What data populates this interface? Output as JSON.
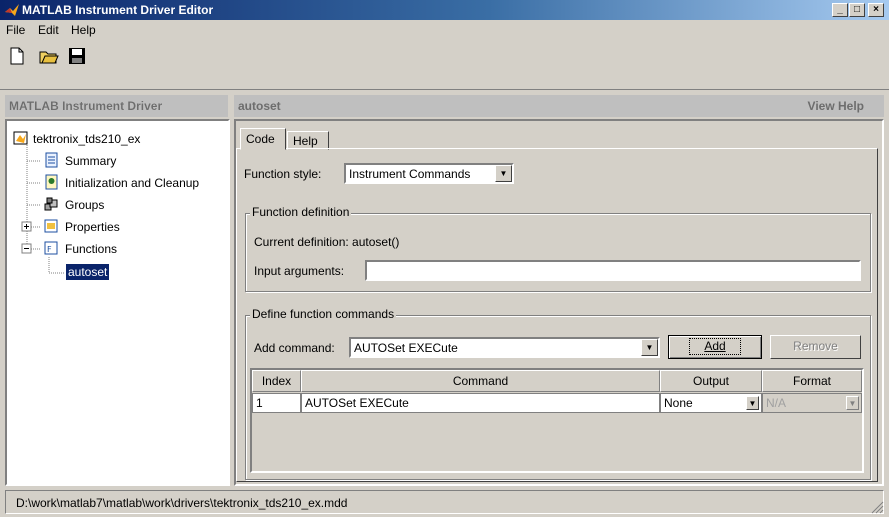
{
  "window": {
    "title": "MATLAB Instrument Driver Editor",
    "minimize": "_",
    "maximize": "□",
    "close": "×"
  },
  "menu": {
    "items": [
      "File",
      "Edit",
      "Help"
    ]
  },
  "toolbar": {
    "new": "new-file-icon",
    "open": "open-folder-icon",
    "save": "save-disk-icon"
  },
  "left_panel": {
    "header": "MATLAB Instrument Driver",
    "tree": {
      "root": "tektronix_tds210_ex",
      "items": [
        "Summary",
        "Initialization and Cleanup",
        "Groups",
        "Properties",
        "Functions"
      ],
      "function_child": "autoset"
    }
  },
  "right_panel": {
    "header": "autoset",
    "view_help": "View Help",
    "tabs": [
      "Code",
      "Help"
    ],
    "function_style_label": "Function style:",
    "function_style_value": "Instrument Commands",
    "function_definition": {
      "legend": "Function definition",
      "current_definition": "Current definition: autoset()",
      "input_arguments_label": "Input arguments:",
      "input_arguments_value": ""
    },
    "define_commands": {
      "legend": "Define function commands",
      "add_command_label": "Add command:",
      "add_command_value": "AUTOSet EXECute",
      "add_button": "Add",
      "remove_button": "Remove",
      "table": {
        "columns": [
          "Index",
          "Command",
          "Output",
          "Format"
        ],
        "rows": [
          {
            "index": "1",
            "command": "AUTOSet EXECute",
            "output": "None",
            "format": "N/A"
          }
        ]
      }
    }
  },
  "status_bar": {
    "path": "D:\\work\\matlab7\\matlab\\work\\drivers\\tektronix_tds210_ex.mdd"
  }
}
